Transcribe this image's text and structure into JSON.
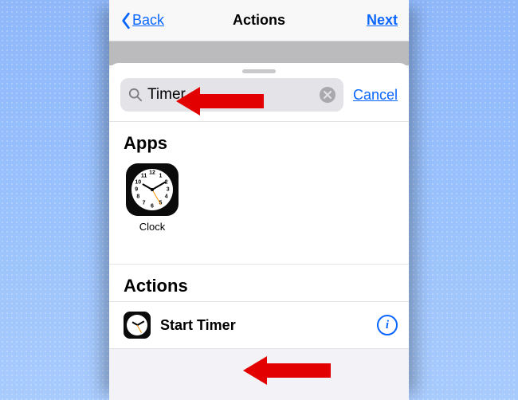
{
  "header": {
    "back_label": "Back",
    "title": "Actions",
    "next_label": "Next"
  },
  "search": {
    "term": "Timer",
    "cancel_label": "Cancel"
  },
  "sections": {
    "apps_header": "Apps",
    "actions_header": "Actions"
  },
  "apps": [
    {
      "label": "Clock",
      "icon": "clock-icon"
    }
  ],
  "actions": [
    {
      "label": "Start Timer",
      "icon": "clock-icon"
    }
  ],
  "colors": {
    "accent": "#0a66ff",
    "annotation": "#e30000"
  }
}
